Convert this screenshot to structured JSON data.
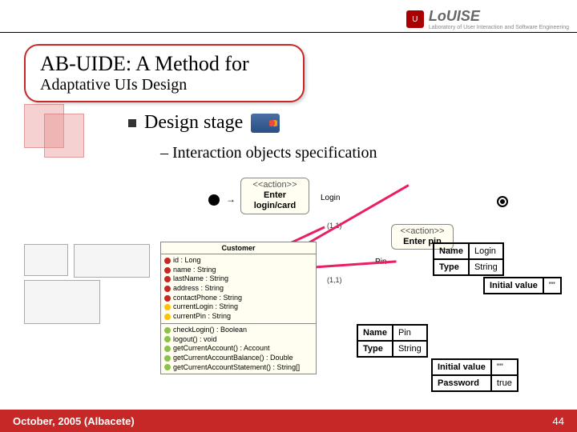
{
  "brand": {
    "logo_letters": "U",
    "name": "LoUISE",
    "subtitle": "Laboratory of User Interaction\nand Software Engineering"
  },
  "title": {
    "main": "AB-UIDE: A Method for",
    "sub": "Adaptative UIs Design"
  },
  "content": {
    "bullet": "Design stage",
    "sub_bullet": "– Interaction objects specification"
  },
  "activity_diagram": {
    "stereo": "<<action>>",
    "action1": "Enter\nlogin/card",
    "action2": "Enter pin",
    "label_login": "Login",
    "label_pin": "Pin",
    "guard": "(1,1)"
  },
  "class_box": {
    "name": "Customer",
    "attrs": [
      "id : Long",
      "name : String",
      "lastName : String",
      "address : String",
      "contactPhone : String",
      "currentLogin : String",
      "currentPin : String"
    ],
    "ops": [
      "checkLogin() : Boolean",
      "logout() : void",
      "getCurrentAccount() : Account",
      "getCurrentAccountBalance() : Double",
      "getCurrentAccountStatement() : String[]"
    ]
  },
  "spec_login": {
    "r1_label": "Name",
    "r1_value": "Login",
    "r2_label": "Type",
    "r2_value": "String",
    "r3_label": "Initial value",
    "r3_value": "\"\""
  },
  "spec_pin": {
    "r1_label": "Name",
    "r1_value": "Pin",
    "r2_label": "Type",
    "r2_value": "String",
    "r3_label": "Initial value",
    "r3_value": "\"\"",
    "r4_label": "Password",
    "r4_value": "true"
  },
  "footer": {
    "left": "October, 2005 (Albacete)",
    "page": "44"
  }
}
